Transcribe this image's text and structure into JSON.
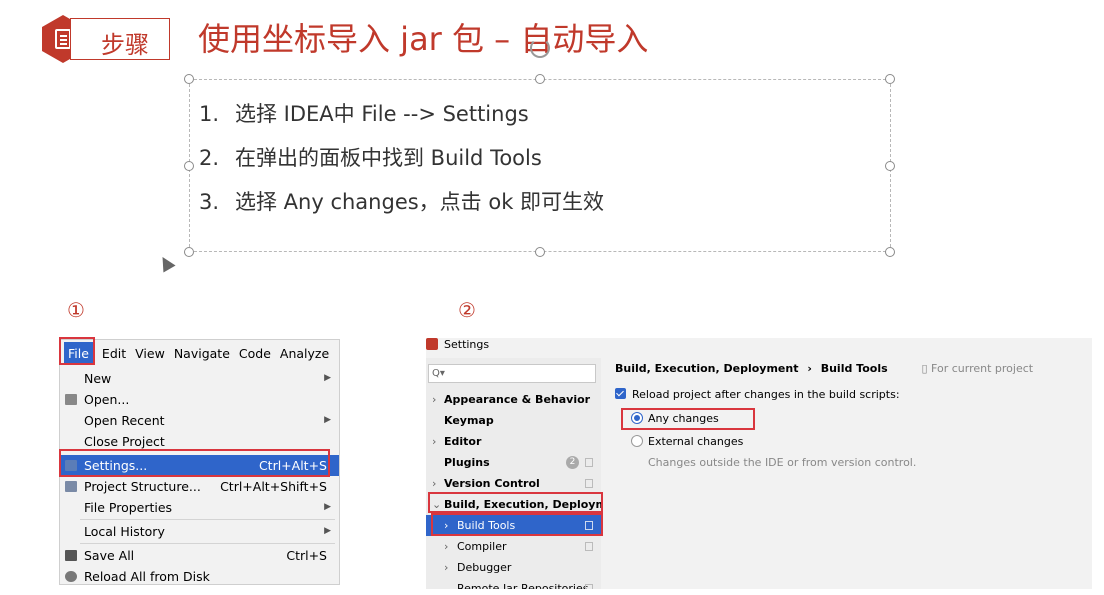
{
  "header": {
    "step_label": "步骤",
    "title": "使用坐标导入 jar 包 – 自动导入"
  },
  "steps": [
    {
      "num": "1.",
      "text": "选择 IDEA中 File --> Settings"
    },
    {
      "num": "2.",
      "text": "在弹出的面板中找到 Build Tools"
    },
    {
      "num": "3.",
      "text": "选择 Any changes，点击 ok 即可生效"
    }
  ],
  "markers": {
    "first": "①",
    "second": "②"
  },
  "file_menu": {
    "menubar": [
      "File",
      "Edit",
      "View",
      "Navigate",
      "Code",
      "Analyze"
    ],
    "items": [
      {
        "label": "New",
        "shortcut": "",
        "submenu": true
      },
      {
        "label": "Open...",
        "shortcut": "",
        "submenu": false
      },
      {
        "label": "Open Recent",
        "shortcut": "",
        "submenu": true
      },
      {
        "label": "Close Project",
        "shortcut": "",
        "submenu": false
      },
      {
        "label": "Settings...",
        "shortcut": "Ctrl+Alt+S",
        "submenu": false,
        "selected": true
      },
      {
        "label": "Project Structure...",
        "shortcut": "Ctrl+Alt+Shift+S",
        "submenu": false
      },
      {
        "label": "File Properties",
        "shortcut": "",
        "submenu": true
      },
      {
        "label": "Local History",
        "shortcut": "",
        "submenu": true
      },
      {
        "label": "Save All",
        "shortcut": "Ctrl+S",
        "submenu": false
      },
      {
        "label": "Reload All from Disk",
        "shortcut": "",
        "submenu": false
      }
    ]
  },
  "settings": {
    "window_title": "Settings",
    "search_placeholder": "Q▾",
    "tree": [
      {
        "label": "Appearance & Behavior",
        "expandable": true
      },
      {
        "label": "Keymap",
        "expandable": false
      },
      {
        "label": "Editor",
        "expandable": true
      },
      {
        "label": "Plugins",
        "expandable": false,
        "badge": "2"
      },
      {
        "label": "Version Control",
        "expandable": true
      },
      {
        "label": "Build, Execution, Deployment",
        "expanded": true
      },
      {
        "label": "Build Tools",
        "child": true,
        "selected": true
      },
      {
        "label": "Compiler",
        "child": true
      },
      {
        "label": "Debugger",
        "child": true
      },
      {
        "label": "Remote Jar Repositories",
        "child": true
      }
    ],
    "breadcrumb_parent": "Build, Execution, Deployment",
    "breadcrumb_separator": "›",
    "breadcrumb_current": "Build Tools",
    "scope_note": "For current project",
    "reload_checkbox_label": "Reload project after changes in the build scripts:",
    "reload_checked": true,
    "radio_any": "Any changes",
    "radio_external": "External changes",
    "radio_external_hint": "Changes outside the IDE or from version control."
  },
  "colors": {
    "accent_red": "#c0392b",
    "highlight_red": "#d9363e",
    "selection_blue": "#2f65ca"
  }
}
